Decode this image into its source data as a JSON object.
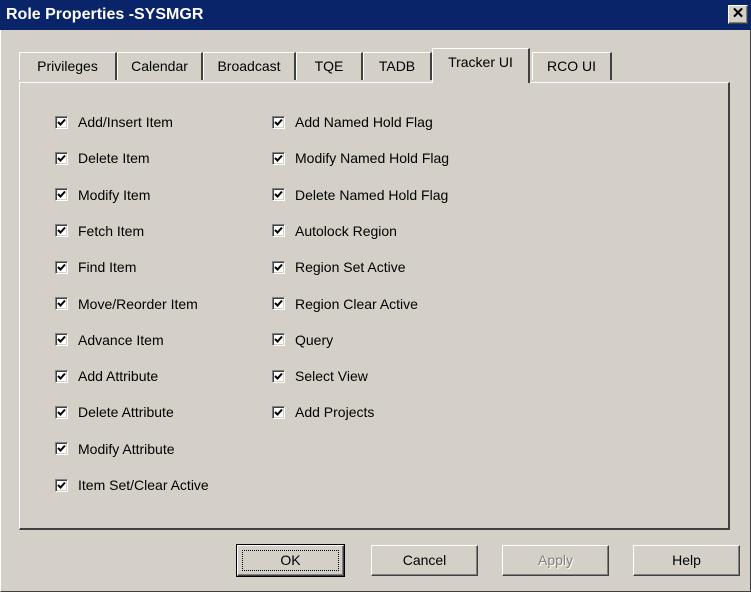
{
  "window": {
    "title": "Role Properties -SYSMGR",
    "close_glyph": "✕"
  },
  "tabs": [
    {
      "label": "Privileges"
    },
    {
      "label": "Calendar"
    },
    {
      "label": "Broadcast"
    },
    {
      "label": "TQE"
    },
    {
      "label": "TADB"
    },
    {
      "label": "Tracker UI",
      "active": true
    },
    {
      "label": "RCO UI"
    }
  ],
  "left_column": [
    {
      "label": "Add/Insert Item",
      "checked": true
    },
    {
      "label": "Delete Item",
      "checked": true
    },
    {
      "label": "Modify Item",
      "checked": true
    },
    {
      "label": "Fetch Item",
      "checked": true
    },
    {
      "label": "Find Item",
      "checked": true
    },
    {
      "label": "Move/Reorder Item",
      "checked": true
    },
    {
      "label": "Advance Item",
      "checked": true
    },
    {
      "label": "Add Attribute",
      "checked": true
    },
    {
      "label": "Delete Attribute",
      "checked": true
    },
    {
      "label": "Modify Attribute",
      "checked": true
    },
    {
      "label": "Item Set/Clear Active",
      "checked": true
    }
  ],
  "right_column": [
    {
      "label": "Add Named Hold Flag",
      "checked": true
    },
    {
      "label": "Modify Named Hold Flag",
      "checked": true
    },
    {
      "label": "Delete Named Hold Flag",
      "checked": true
    },
    {
      "label": "Autolock Region",
      "checked": true
    },
    {
      "label": "Region Set Active",
      "checked": true
    },
    {
      "label": "Region Clear Active",
      "checked": true
    },
    {
      "label": "Query",
      "checked": true
    },
    {
      "label": "Select View",
      "checked": true
    },
    {
      "label": "Add Projects",
      "checked": true
    }
  ],
  "buttons": {
    "ok": "OK",
    "cancel": "Cancel",
    "apply": "Apply",
    "help": "Help"
  },
  "colors": {
    "title_bar": "#0a246a",
    "face": "#d4d0c8",
    "disabled_text": "#808080"
  }
}
